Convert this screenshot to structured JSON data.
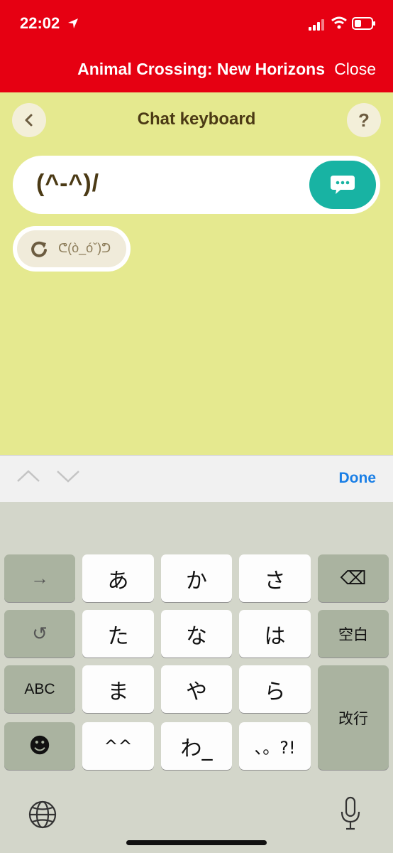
{
  "status": {
    "time": "22:02"
  },
  "nav": {
    "title": "Animal Crossing: New Horizons",
    "close": "Close"
  },
  "app": {
    "title": "Chat keyboard",
    "help": "?",
    "input_value": "(^-^)/",
    "suggestion": "ᕦ(ò_óˇ)ᕤ"
  },
  "toolbar": {
    "done": "Done"
  },
  "keyboard": {
    "rows": [
      [
        "→",
        "あ",
        "か",
        "さ",
        "⌫"
      ],
      [
        "↺",
        "た",
        "な",
        "は",
        "空白"
      ],
      [
        "ABC",
        "ま",
        "や",
        "ら",
        "改行"
      ],
      [
        "☻",
        "^^",
        "わ_",
        "、。?!"
      ]
    ]
  },
  "colors": {
    "header": "#e60012",
    "app_bg": "#e5e98f",
    "send": "#18b3a3",
    "done": "#1a7fe6"
  },
  "icons": [
    "location-arrow-icon",
    "signal-icon",
    "wifi-icon",
    "battery-icon",
    "back-chevron-icon",
    "chat-bubble-icon",
    "refresh-icon",
    "chevron-up-icon",
    "chevron-down-icon",
    "globe-icon",
    "microphone-icon"
  ]
}
